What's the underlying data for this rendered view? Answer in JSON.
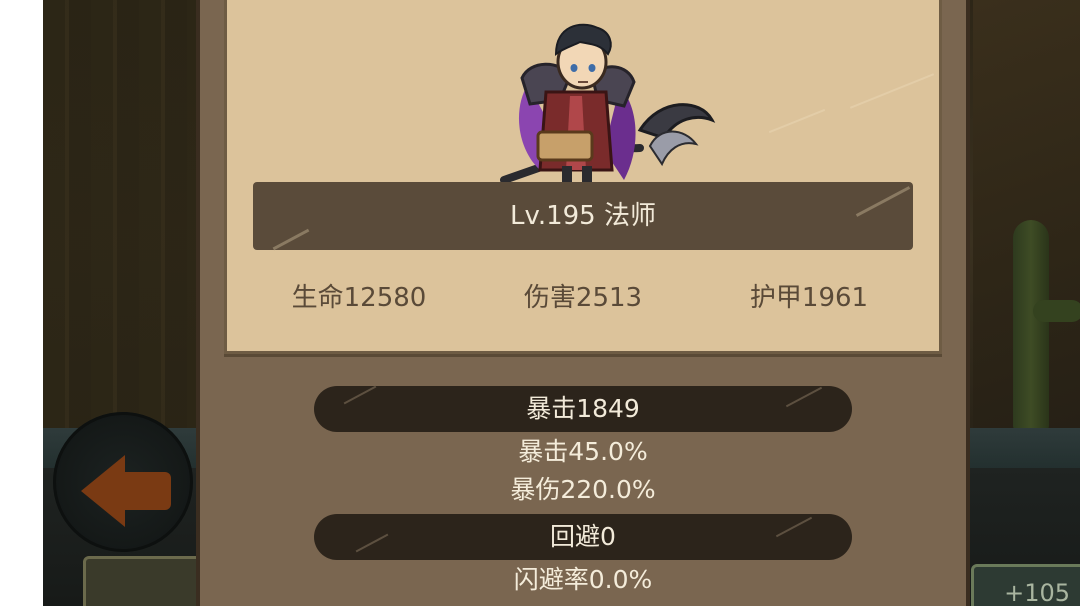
{
  "hero": {
    "level_class": "Lv.195 法师",
    "main_stats": [
      {
        "label": "生命12580"
      },
      {
        "label": "伤害2513"
      },
      {
        "label": "护甲1961"
      }
    ]
  },
  "details": {
    "crit_header": "暴击1849",
    "crit_rate": "暴击45.0%",
    "crit_damage": "暴伤220.0%",
    "evade_header": "回避0",
    "evade_rate": "闪避率0.0%"
  },
  "background": {
    "bottom_right_counter": "+105"
  },
  "colors": {
    "card": "#dcc39b",
    "frame": "#7a6650",
    "banner": "#5a4b3a",
    "pill": "#2c241b",
    "text_light": "#f2ead9",
    "text_dark": "#5a4a38"
  }
}
